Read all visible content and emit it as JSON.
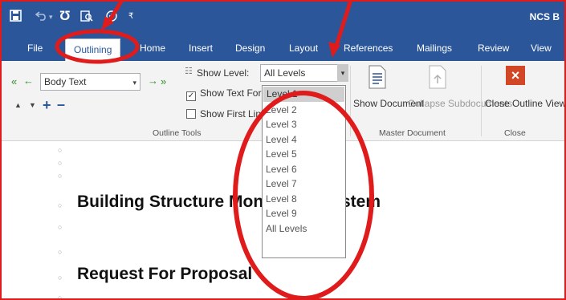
{
  "app_title": "NCS B",
  "tabs": [
    {
      "label": "File"
    },
    {
      "label": "Outlining",
      "active": true
    },
    {
      "label": "Home"
    },
    {
      "label": "Insert"
    },
    {
      "label": "Design"
    },
    {
      "label": "Layout"
    },
    {
      "label": "References"
    },
    {
      "label": "Mailings"
    },
    {
      "label": "Review"
    },
    {
      "label": "View"
    }
  ],
  "ribbon": {
    "outline_tools": {
      "level_dropdown": "Body Text",
      "show_level_label": "Show Level:",
      "show_level_value": "All Levels",
      "show_text_formatting": "Show Text Formatting",
      "show_text_formatting_checked": true,
      "show_first_line": "Show First Line Only",
      "show_first_line_checked": false,
      "group_label": "Outline Tools"
    },
    "master_document": {
      "show_document": "Show Document",
      "collapse_subdocuments": "Collapse Subdocuments",
      "group_label": "Master Document"
    },
    "close": {
      "close_outline_view": "Close Outline View",
      "group_label": "Close"
    }
  },
  "level_options": [
    "Level 1",
    "Level 2",
    "Level 3",
    "Level 4",
    "Level 5",
    "Level 6",
    "Level 7",
    "Level 8",
    "Level 9",
    "All Levels"
  ],
  "level_selected": "Level 1",
  "document": {
    "heading1": "Building Structure Monitoring System",
    "heading2": "Request For Proposal"
  },
  "colors": {
    "ribbon_blue": "#2b579a",
    "annotation_red": "#e01b1b",
    "close_red": "#d24726"
  },
  "icons": [
    "save-icon",
    "undo-icon",
    "redo-icon",
    "print-preview-icon",
    "touch-mode-icon",
    "promote-to-heading-icon",
    "promote-icon",
    "demote-icon",
    "demote-to-body-icon",
    "move-up-icon",
    "move-down-icon",
    "expand-icon",
    "collapse-icon",
    "show-document-icon",
    "collapse-subdocuments-icon",
    "close-x-icon"
  ]
}
